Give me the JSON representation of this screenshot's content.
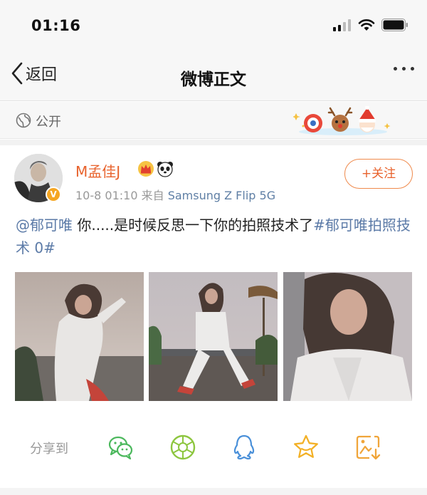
{
  "status_bar": {
    "time": "01:16",
    "icons": [
      "signal-icon",
      "wifi-icon",
      "battery-icon"
    ]
  },
  "nav": {
    "back_label": "返回",
    "title": "微博正文",
    "more_icon": "more-dots-icon"
  },
  "visibility": {
    "label": "公开",
    "icon": "globe-icon"
  },
  "post": {
    "author": {
      "name": "M孟佳J",
      "badges": [
        "crown-icon",
        "panda-icon"
      ],
      "verified_badge": "V"
    },
    "time": "10-8 01:10",
    "source_prefix": "来自",
    "source": "Samsung Z Flip 5G",
    "follow_label": "+关注",
    "text": {
      "mention": "@郁可唯",
      "body": " 你.....是时候反思一下你的拍照技术了",
      "hashtag": "#郁可唯拍照技术 0#"
    },
    "photos": [
      "photo-1",
      "photo-2",
      "photo-3"
    ]
  },
  "share": {
    "label": "分享到",
    "targets": [
      "wechat-icon",
      "moments-icon",
      "qq-icon",
      "favorite-icon",
      "save-image-icon"
    ]
  },
  "colors": {
    "accent_orange": "#e8622c",
    "link_blue": "#5b7aa7",
    "icon_green": "#4bb85c",
    "icon_blue": "#4a90d9",
    "icon_yellow": "#f3b127"
  }
}
